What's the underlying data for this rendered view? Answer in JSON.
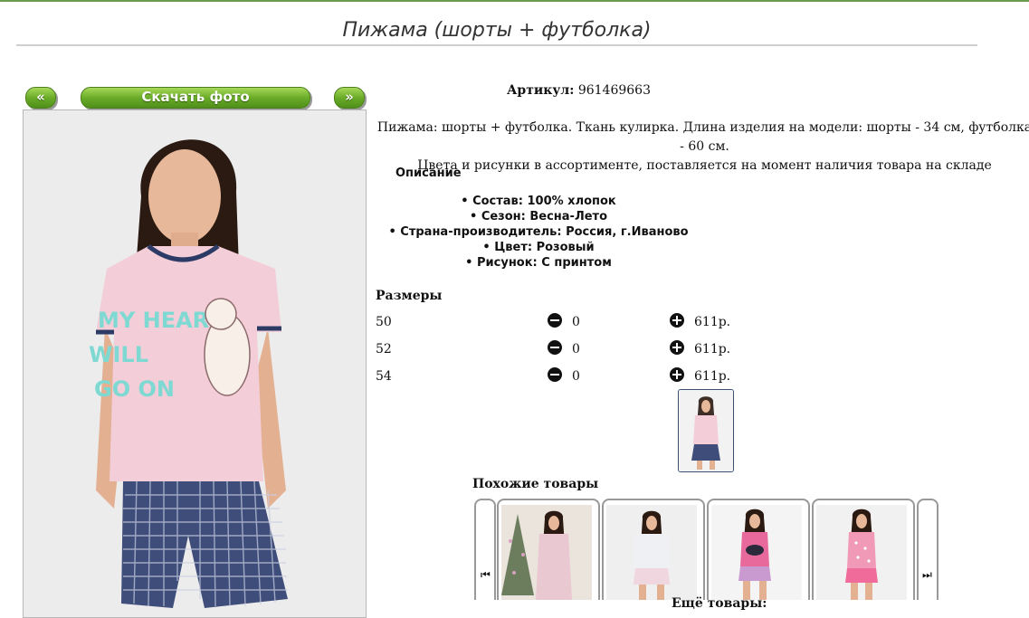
{
  "page": {
    "title": "Пижама (шорты + футболка)"
  },
  "gallery": {
    "prev_label": "«",
    "download_label": "Скачать фото",
    "next_label": "»"
  },
  "product": {
    "articul_label": "Артикул:",
    "articul_value": "961469663",
    "description_line1": "Пижама: шорты + футболка. Ткань кулирка. Длина изделия на модели: шорты - 34 см, футболка - 60 см.",
    "description_line2": "Цвета и рисунки в ассортименте, поставляется на момент наличия товара на складе",
    "specs_title": "Описание",
    "specs": [
      "Состав: 100% хлопок",
      "Сезон: Весна-Лето",
      "Страна-производитель: Россия, г.Иваново",
      "Цвет: Розовый",
      "Рисунок: С принтом"
    ],
    "shirt_print": "MY HEART WILL GO ON"
  },
  "sizes": {
    "title": "Размеры",
    "rows": [
      {
        "size": "50",
        "qty": "0",
        "price": "611р."
      },
      {
        "size": "52",
        "qty": "0",
        "price": "611р."
      },
      {
        "size": "54",
        "qty": "0",
        "price": "611р."
      }
    ]
  },
  "similar": {
    "title": "Похожие товары",
    "more_label": "Ещё товары:"
  },
  "colors": {
    "accent_green": "#6aac28",
    "shirt_pink": "#f3cdd8",
    "print_mint": "#7fd9d3",
    "shorts_navy": "#2c3a66"
  }
}
